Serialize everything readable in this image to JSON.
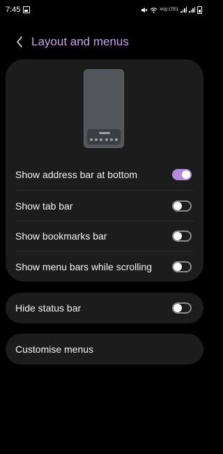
{
  "status_bar": {
    "time": "7:45",
    "network_label": "Vo)) LTE1",
    "left_icons": [
      "gallery-icon"
    ],
    "right_icons": [
      "mute-icon",
      "wifi-icon",
      "signal-icon",
      "signal-icon",
      "battery-icon"
    ]
  },
  "header": {
    "back_icon": "chevron-left-icon",
    "title": "Layout and menus"
  },
  "settings": {
    "preview_image": "browser-layout-preview",
    "items": [
      {
        "label": "Show address bar at bottom",
        "enabled": true
      },
      {
        "label": "Show tab bar",
        "enabled": false
      },
      {
        "label": "Show bookmarks bar",
        "enabled": false
      },
      {
        "label": "Show menu bars while scrolling",
        "enabled": false
      }
    ]
  },
  "status_section": {
    "label": "Hide status bar",
    "enabled": false
  },
  "menus_section": {
    "label": "Customise menus"
  },
  "colors": {
    "accent": "#b38be0",
    "title": "#c8a2ea",
    "card": "#1c1c1c",
    "background": "#000000"
  }
}
